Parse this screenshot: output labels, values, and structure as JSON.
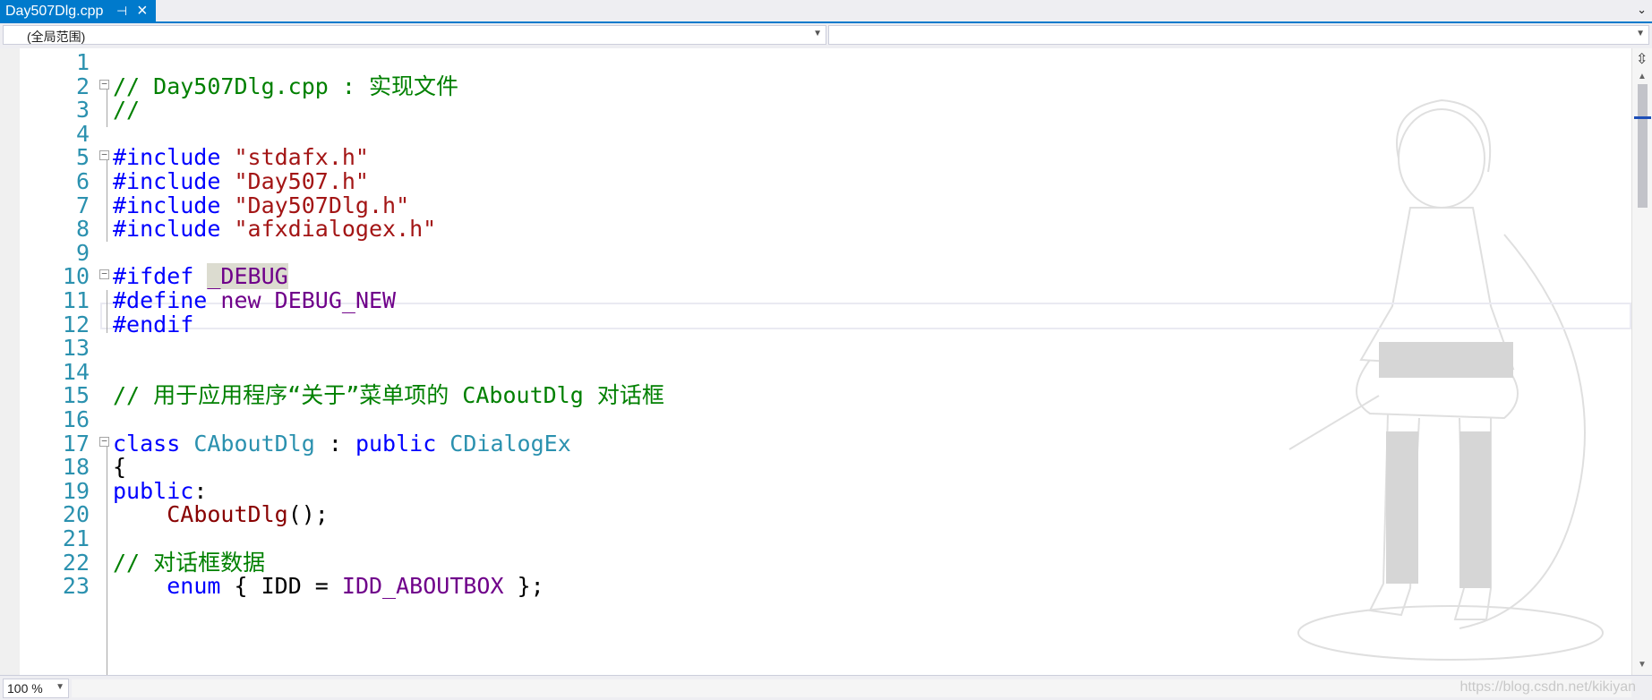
{
  "tab": {
    "title": "Day507Dlg.cpp",
    "pin_icon": "pin-icon",
    "close_icon": "close-icon"
  },
  "nav": {
    "scope": "(全局范围)",
    "member": ""
  },
  "editor": {
    "lines": [
      {
        "n": "1",
        "tokens": []
      },
      {
        "n": "2",
        "fold": true,
        "tokens": [
          {
            "t": "// Day507Dlg.cpp : 实现文件",
            "c": "comment"
          }
        ]
      },
      {
        "n": "3",
        "tokens": [
          {
            "t": "//",
            "c": "comment"
          }
        ]
      },
      {
        "n": "4",
        "tokens": []
      },
      {
        "n": "5",
        "fold": true,
        "tokens": [
          {
            "t": "#include ",
            "c": "kw"
          },
          {
            "t": "\"stdafx.h\"",
            "c": "str"
          }
        ]
      },
      {
        "n": "6",
        "tokens": [
          {
            "t": "#include ",
            "c": "kw"
          },
          {
            "t": "\"Day507.h\"",
            "c": "str"
          }
        ]
      },
      {
        "n": "7",
        "tokens": [
          {
            "t": "#include ",
            "c": "kw"
          },
          {
            "t": "\"Day507Dlg.h\"",
            "c": "str"
          }
        ]
      },
      {
        "n": "8",
        "tokens": [
          {
            "t": "#include ",
            "c": "kw"
          },
          {
            "t": "\"afxdialogex.h\"",
            "c": "str"
          }
        ]
      },
      {
        "n": "9",
        "tokens": []
      },
      {
        "n": "10",
        "fold": true,
        "tokens": [
          {
            "t": "#ifdef ",
            "c": "kw"
          },
          {
            "t": "_DEBUG",
            "c": "hl"
          }
        ]
      },
      {
        "n": "11",
        "tokens": [
          {
            "t": "#define ",
            "c": "kw"
          },
          {
            "t": "new ",
            "c": "pre"
          },
          {
            "t": "DEBUG_NEW",
            "c": "pre"
          }
        ]
      },
      {
        "n": "12",
        "tokens": [
          {
            "t": "#endif",
            "c": "kw"
          }
        ]
      },
      {
        "n": "13",
        "tokens": []
      },
      {
        "n": "14",
        "tokens": []
      },
      {
        "n": "15",
        "tokens": [
          {
            "t": "// 用于应用程序“关于”菜单项的 CAboutDlg 对话框",
            "c": "comment"
          }
        ]
      },
      {
        "n": "16",
        "tokens": []
      },
      {
        "n": "17",
        "fold": true,
        "tokens": [
          {
            "t": "class ",
            "c": "kw"
          },
          {
            "t": "CAboutDlg",
            "c": "type"
          },
          {
            "t": " : ",
            "c": "plain"
          },
          {
            "t": "public ",
            "c": "kw"
          },
          {
            "t": "CDialogEx",
            "c": "type"
          }
        ]
      },
      {
        "n": "18",
        "tokens": [
          {
            "t": "{",
            "c": "plain"
          }
        ]
      },
      {
        "n": "19",
        "tokens": [
          {
            "t": "public",
            "c": "kw"
          },
          {
            "t": ":",
            "c": "plain"
          }
        ]
      },
      {
        "n": "20",
        "tokens": [
          {
            "t": "    ",
            "c": "plain"
          },
          {
            "t": "CAboutDlg",
            "c": "func"
          },
          {
            "t": "();",
            "c": "plain"
          }
        ]
      },
      {
        "n": "21",
        "tokens": []
      },
      {
        "n": "22",
        "tokens": [
          {
            "t": "// 对话框数据",
            "c": "comment"
          }
        ]
      },
      {
        "n": "23",
        "tokens": [
          {
            "t": "    ",
            "c": "plain"
          },
          {
            "t": "enum",
            "c": "kw"
          },
          {
            "t": " { IDD = ",
            "c": "plain"
          },
          {
            "t": "IDD_ABOUTBOX",
            "c": "pre"
          },
          {
            "t": " };",
            "c": "plain"
          }
        ]
      }
    ]
  },
  "status": {
    "zoom": "100 %",
    "watermark_url": "https://blog.csdn.net/kikiyan"
  },
  "colors": {
    "accent": "#007acc",
    "comment": "#008000",
    "keyword": "#0000ff",
    "string": "#a31515",
    "type": "#2b91af",
    "macro": "#6f008a"
  }
}
